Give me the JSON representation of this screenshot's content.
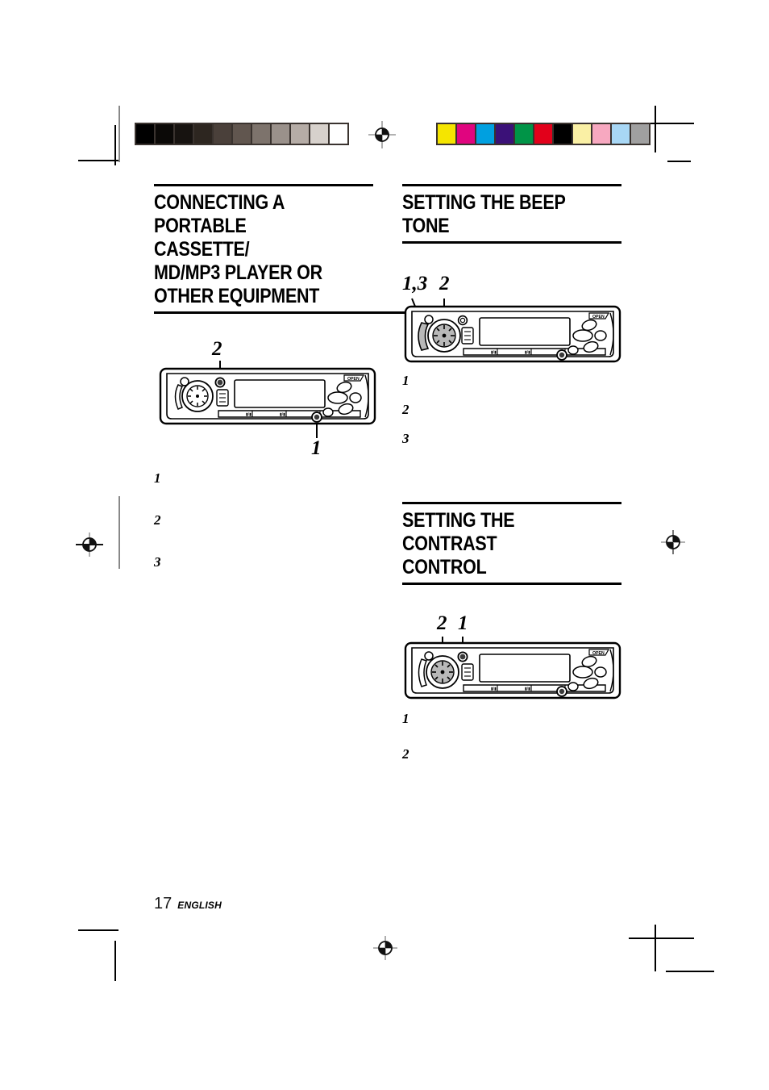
{
  "document": {
    "page_number": "17",
    "language": "ENGLISH"
  },
  "calibration": {
    "grayscale_label": "grayscale-calibration-bar",
    "grayscale_swatches": [
      "#000000",
      "#0b0907",
      "#171310",
      "#2d2620",
      "#4a403a",
      "#61564f",
      "#7d736c",
      "#9a918b",
      "#b5aca6",
      "#d7d1cc",
      "#ffffff"
    ],
    "color_label": "color-calibration-bar",
    "color_swatches": [
      "#f5e500",
      "#e0057f",
      "#00a0e0",
      "#3b1178",
      "#009447",
      "#e2001a",
      "#000000",
      "#faf0a5",
      "#f7a8c0",
      "#a8d7f5",
      "#a0a0a0"
    ]
  },
  "left_column": {
    "section": {
      "heading": "CONNECTING A\nPORTABLE CASSETTE/\nMD/MP3 PLAYER OR\nOTHER EQUIPMENT",
      "diagram": {
        "name": "car-stereo-faceplate-diagram",
        "open_label": "OPEN",
        "callouts": [
          {
            "label": "2",
            "target": "upper-left-round-button"
          },
          {
            "label": "1",
            "target": "lower-right-round-jack"
          }
        ]
      },
      "steps": [
        {
          "number": "1",
          "text": ""
        },
        {
          "number": "2",
          "text": ""
        },
        {
          "number": "3",
          "text": ""
        }
      ]
    }
  },
  "right_column": {
    "sections": [
      {
        "heading": "SETTING THE BEEP TONE",
        "diagram": {
          "name": "car-stereo-faceplate-diagram",
          "open_label": "OPEN",
          "callouts": [
            {
              "label": "1,3",
              "target": "left-side-shaded-button"
            },
            {
              "label": "2",
              "target": "rotary-dial-center"
            }
          ]
        },
        "steps": [
          {
            "number": "1",
            "text": ""
          },
          {
            "number": "2",
            "text": ""
          },
          {
            "number": "3",
            "text": ""
          }
        ]
      },
      {
        "heading": "SETTING THE CONTRAST\nCONTROL",
        "diagram": {
          "name": "car-stereo-faceplate-diagram",
          "open_label": "OPEN",
          "callouts": [
            {
              "label": "2",
              "target": "rotary-dial-center"
            },
            {
              "label": "1",
              "target": "upper-round-button"
            }
          ]
        },
        "steps": [
          {
            "number": "1",
            "text": ""
          },
          {
            "number": "2",
            "text": ""
          }
        ]
      }
    ]
  }
}
